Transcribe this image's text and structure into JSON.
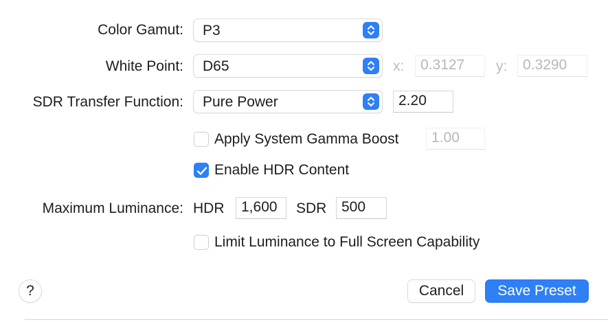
{
  "color_gamut": {
    "label": "Color Gamut:",
    "value": "P3"
  },
  "white_point": {
    "label": "White Point:",
    "value": "D65",
    "x_label": "x:",
    "x_value": "0.3127",
    "y_label": "y:",
    "y_value": "0.3290"
  },
  "sdr_transfer": {
    "label": "SDR Transfer Function:",
    "value": "Pure Power",
    "gamma": "2.20"
  },
  "gamma_boost": {
    "label": "Apply System Gamma Boost",
    "checked": false,
    "value": "1.00"
  },
  "hdr_content": {
    "label": "Enable HDR Content",
    "checked": true
  },
  "max_luminance": {
    "label": "Maximum Luminance:",
    "hdr_label": "HDR",
    "hdr_value": "1,600",
    "sdr_label": "SDR",
    "sdr_value": "500"
  },
  "limit_luminance": {
    "label": "Limit Luminance to Full Screen Capability",
    "checked": false
  },
  "footer": {
    "help_label": "?",
    "cancel_label": "Cancel",
    "save_label": "Save Preset"
  },
  "colors": {
    "accent": "#2f7ff5",
    "disabled_text": "#b7b7b7"
  },
  "icons": {
    "popup_stepper": "up-down-chevron-icon",
    "checkmark": "checkmark-icon"
  }
}
